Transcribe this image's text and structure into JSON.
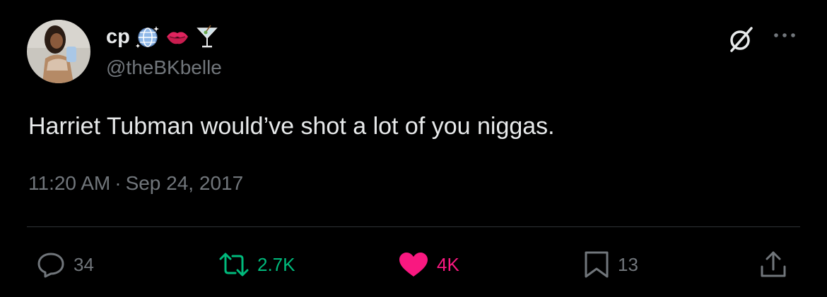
{
  "author": {
    "display_name": "cp",
    "handle": "@theBKbelle",
    "emoji_icons": [
      "globe-with-sparkles-icon",
      "kiss-mark-icon",
      "cocktail-glass-icon"
    ]
  },
  "tweet": {
    "text": "Harriet Tubman would’ve shot a lot of you niggas.",
    "time": "11:20 AM",
    "separator": "·",
    "date": "Sep 24, 2017"
  },
  "actions": {
    "replies": "34",
    "retweets": "2.7K",
    "likes": "4K",
    "bookmarks": "13"
  },
  "colors": {
    "background": "#000000",
    "text": "#e7e9ea",
    "secondary": "#71767b",
    "retweet": "#00ba7c",
    "like": "#f91880",
    "divider": "#2f3336"
  }
}
